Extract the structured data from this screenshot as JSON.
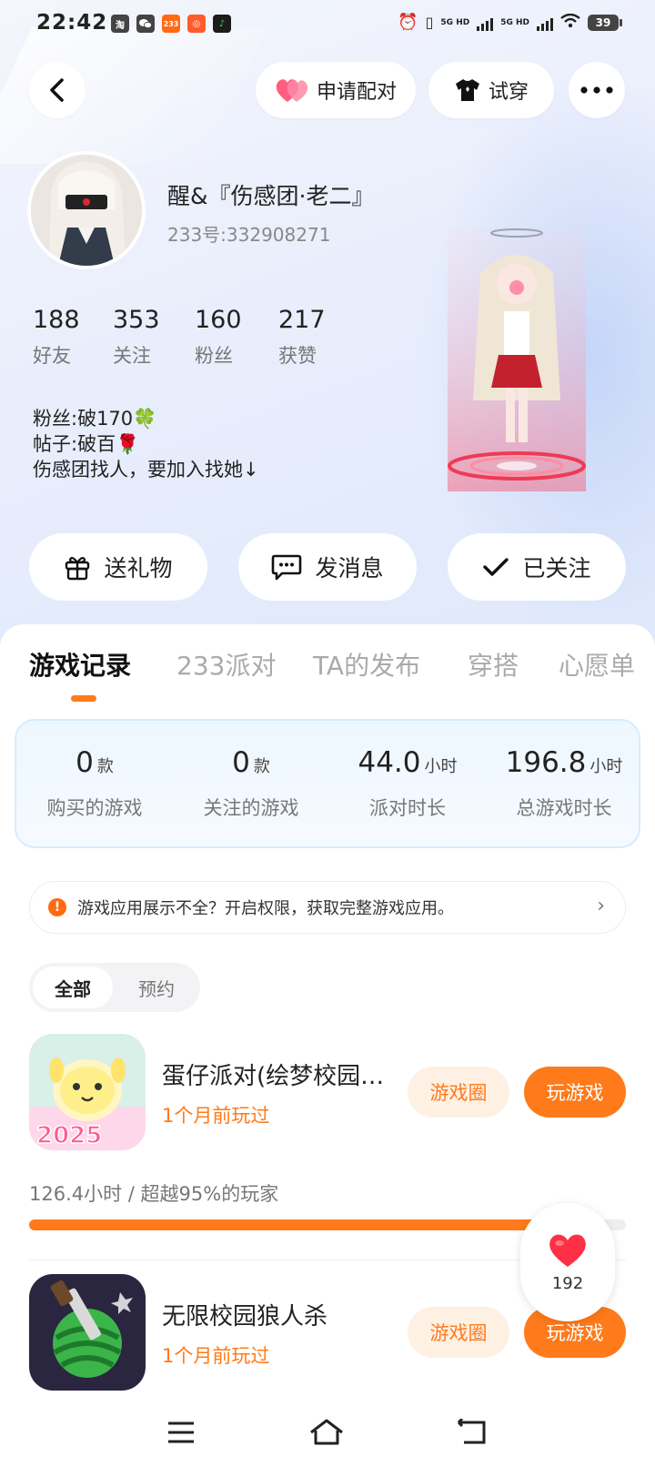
{
  "status_bar": {
    "time": "22:42",
    "apps": [
      {
        "icon": "taobao-icon",
        "text": "淘",
        "color": "#444444"
      },
      {
        "icon": "wechat-icon",
        "text": "",
        "color": "#444444"
      },
      {
        "icon": "233-icon",
        "text": "233",
        "color": "#ff6a13"
      },
      {
        "icon": "app-icon",
        "text": "",
        "color": "#ff5b2a"
      },
      {
        "icon": "music-icon",
        "text": "",
        "color": "#2aa33d"
      }
    ],
    "network": "5G HD",
    "battery": "39"
  },
  "header": {
    "pair_label": "申请配对",
    "try_on_label": "试穿"
  },
  "profile": {
    "nickname": "醒&『伤感团·老二』",
    "uid": "233号:332908271",
    "stats": [
      {
        "num": "188",
        "label": "好友"
      },
      {
        "num": "353",
        "label": "关注"
      },
      {
        "num": "160",
        "label": "粉丝"
      },
      {
        "num": "217",
        "label": "获赞"
      }
    ],
    "bio": [
      "粉丝:破170🍀",
      "帖子:破百🌹",
      "伤感团找人，要加入找她↓"
    ]
  },
  "actions": {
    "gift": "送礼物",
    "message": "发消息",
    "followed": "已关注"
  },
  "tabs": [
    "游戏记录",
    "233派对",
    "TA的发布",
    "穿搭",
    "心愿单"
  ],
  "summary": [
    {
      "num": "0",
      "unit": "款",
      "label": "购买的游戏"
    },
    {
      "num": "0",
      "unit": "款",
      "label": "关注的游戏"
    },
    {
      "num": "44.0",
      "unit": "小时",
      "label": "派对时长"
    },
    {
      "num": "196.8",
      "unit": "小时",
      "label": "总游戏时长"
    }
  ],
  "notice": {
    "text": "游戏应用展示不全？开启权限，获取完整游戏应用。"
  },
  "filter": {
    "all": "全部",
    "reserve": "预约"
  },
  "games": [
    {
      "name": "蛋仔派对(绘梦校园…",
      "played": "1个月前玩过",
      "circle_label": "游戏圈",
      "play_label": "玩游戏"
    },
    {
      "name": "无限校园狼人杀",
      "played": "1个月前玩过",
      "circle_label": "游戏圈",
      "play_label": "玩游戏"
    }
  ],
  "first_game_stats": {
    "text": "126.4小时 / 超越95%的玩家",
    "progress": 0.95
  },
  "like_float": {
    "count": "192"
  }
}
